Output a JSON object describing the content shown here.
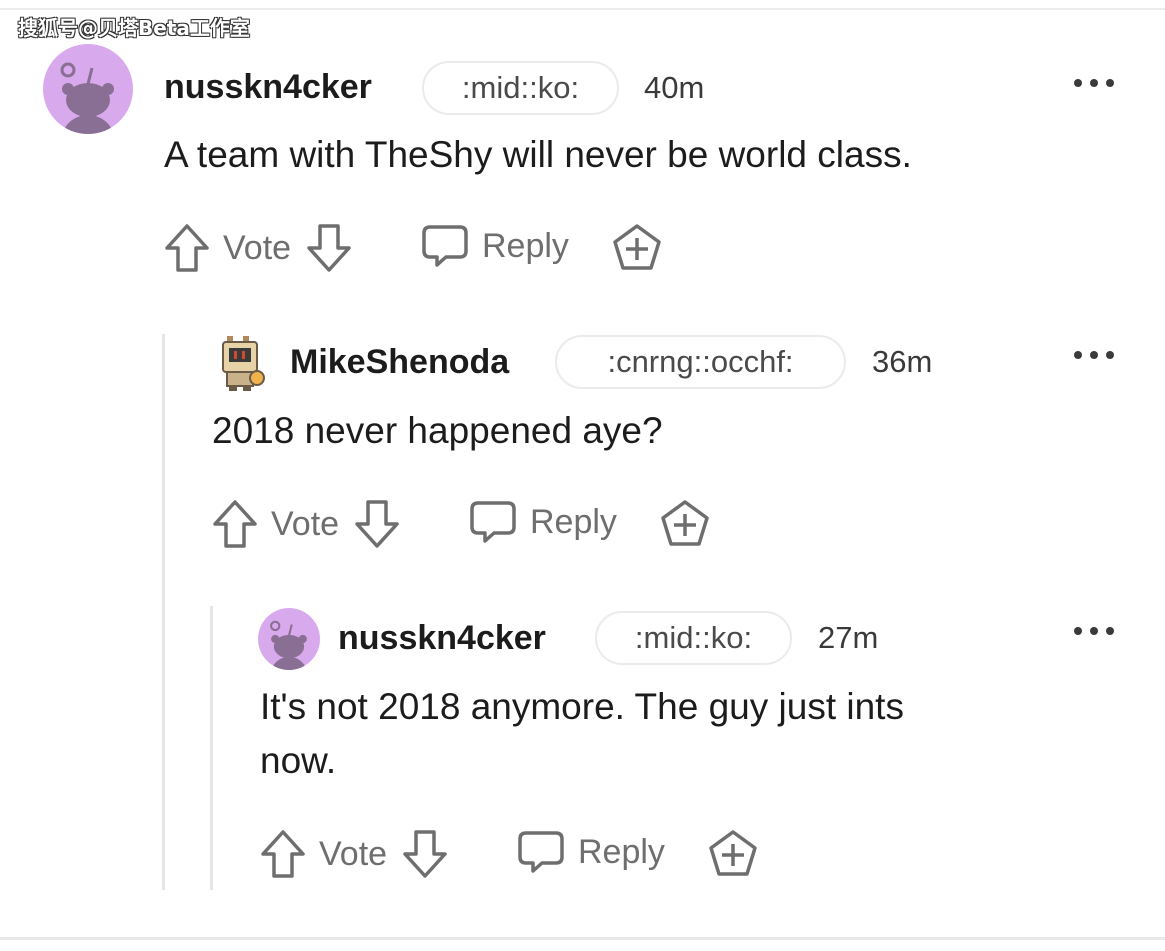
{
  "watermark": "搜狐号@贝塔Beta工作室",
  "comments": [
    {
      "username": "nusskn4cker",
      "flair": ":mid::ko:",
      "time": "40m",
      "text": "A team with TheShy will never be world class.",
      "vote_label": "Vote",
      "reply_label": "Reply",
      "avatar": "snoo-avatar-purple"
    },
    {
      "username": "MikeShenoda",
      "flair": ":cnrng::occhf:",
      "time": "36m",
      "text": "2018 never happened aye?",
      "vote_label": "Vote",
      "reply_label": "Reply",
      "avatar": "robot-avatar"
    },
    {
      "username": "nusskn4cker",
      "flair": ":mid::ko:",
      "time": "27m",
      "text_lines": [
        "It's not 2018 anymore. The guy just ints",
        "now."
      ],
      "vote_label": "Vote",
      "reply_label": "Reply",
      "avatar": "snoo-avatar-purple"
    }
  ],
  "colors": {
    "avatar_bg": "#d9a9ee",
    "snoo": "#8a6f94",
    "text": "#1c1c1c",
    "muted": "#6e6e6e"
  }
}
